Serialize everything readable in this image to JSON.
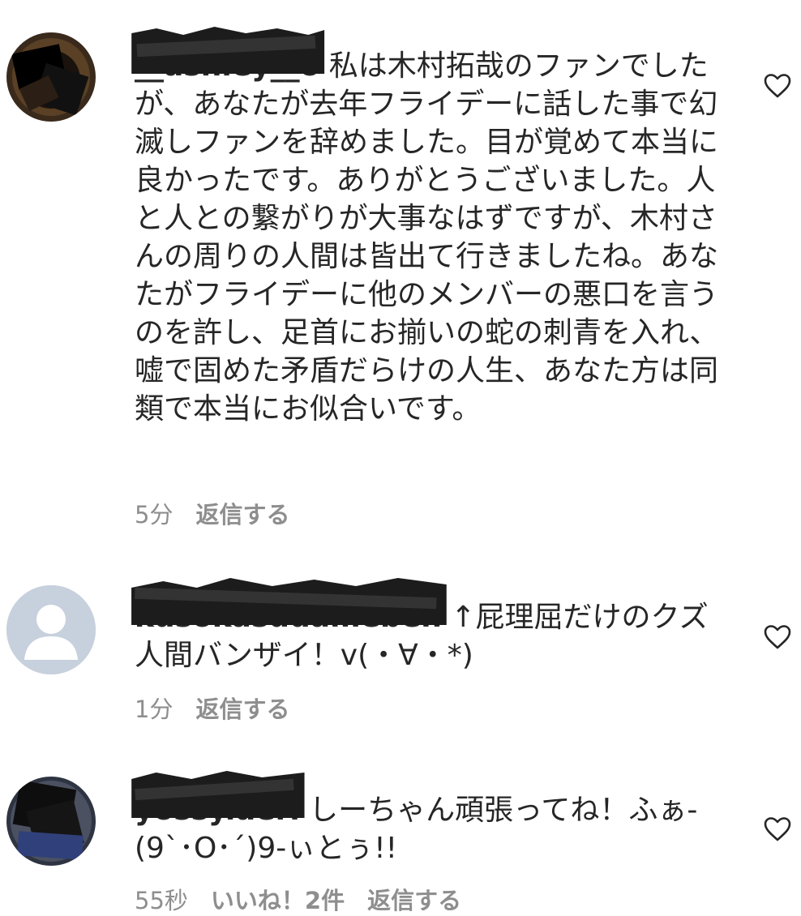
{
  "comments": [
    {
      "username": "__ashley__o",
      "text": "私は木村拓哉のファンでしたが、あなたが去年フライデーに話した事で幻滅しファンを辞めました。目が覚めて本当に良かったです。ありがとうございました。人と人との繋がりが大事なはずですが、木村さんの周りの人間は皆出て行きましたね。あなたがフライデーに他のメンバーの悪口を言うのを許し、足首にお揃いの蛇の刺青を入れ、嘘で固めた矛盾だらけの人生、あなた方は同類で本当にお似合いです。",
      "time": "5分",
      "reply": "返信する",
      "avatar": "dark-photo-avatar"
    },
    {
      "username": "kusokasudameben",
      "text": "↑屁理屈だけのクズ人間バンザイ！v(・∀・*)",
      "time": "1分",
      "reply": "返信する",
      "avatar": "default-user-avatar"
    },
    {
      "username": "yossy.aeri",
      "text": "しーちゃん頑張ってね！ふぁ-(9`･O･´)9-ぃとぅ!!",
      "time": "55秒",
      "likes": "いいね！2件",
      "reply": "返信する",
      "avatar": "dark-photo-avatar"
    }
  ],
  "colors": {
    "text": "#262626",
    "meta": "#8e8e8e",
    "default_avatar_bg": "#c7d0dd"
  }
}
